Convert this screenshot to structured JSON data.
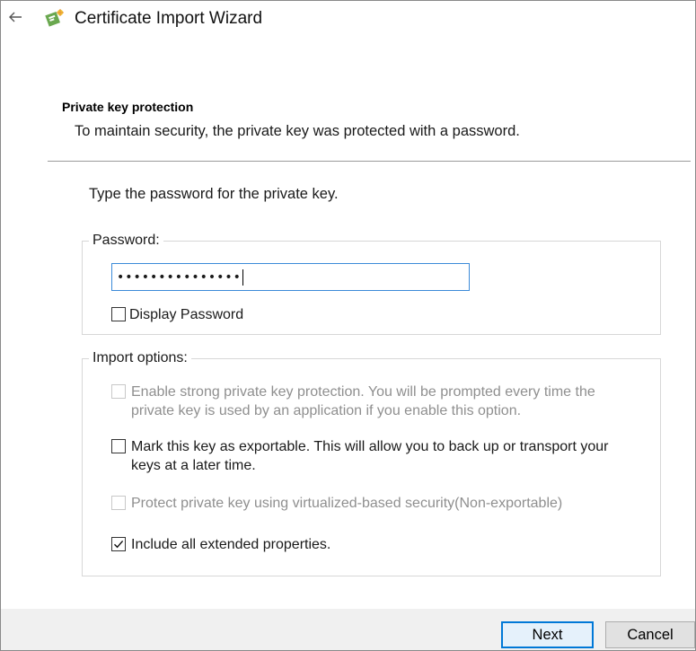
{
  "window": {
    "title": "Certificate Import Wizard"
  },
  "header": {
    "section_title": "Private key protection",
    "section_desc": "To maintain security, the private key was protected with a password."
  },
  "main": {
    "prompt": "Type the password for the private key.",
    "password_group": {
      "legend": "Password:",
      "value": "•••••••••••••••",
      "display_password_label": "Display Password",
      "display_password_checked": false
    },
    "import_options": {
      "legend": "Import options:",
      "options": [
        {
          "label": "Enable strong private key protection. You will be prompted every time the private key is used by an application if you enable this option.",
          "checked": false,
          "enabled": false
        },
        {
          "label": "Mark this key as exportable. This will allow you to back up or transport your keys at a later time.",
          "checked": false,
          "enabled": true
        },
        {
          "label": "Protect private key using virtualized-based security(Non-exportable)",
          "checked": false,
          "enabled": false
        },
        {
          "label": "Include all extended properties.",
          "checked": true,
          "enabled": true
        }
      ]
    }
  },
  "footer": {
    "next_label": "Next",
    "cancel_label": "Cancel"
  },
  "colors": {
    "accent": "#0078d7",
    "input_border": "#3b8ad8",
    "footer_bg": "#f0f0f0"
  }
}
